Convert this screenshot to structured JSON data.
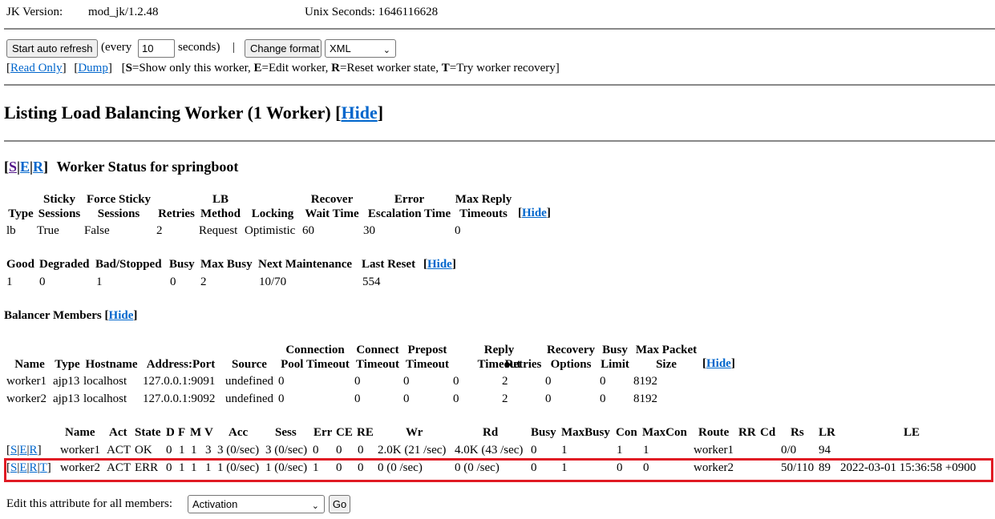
{
  "header": {
    "jk_version_label": "JK Version:",
    "jk_version_value": "mod_jk/1.2.48",
    "unix_seconds": "Unix Seconds: 1646116628"
  },
  "controls": {
    "auto_refresh_button": "Start auto refresh",
    "every_label": "(every",
    "refresh_seconds_value": "10",
    "seconds_label": "seconds)",
    "separator": "|",
    "change_format_button": "Change format",
    "format_select": "XML",
    "read_only_link": "Read Only",
    "dump_link": "Dump",
    "legend": {
      "S": "S",
      "S_text": "=Show only this worker, ",
      "E": "E",
      "E_text": "=Edit worker, ",
      "R": "R",
      "R_text": "=Reset worker state, ",
      "T": "T",
      "T_text": "=Try worker recovery]"
    }
  },
  "listing": {
    "title": "Listing Load Balancing Worker (1 Worker) [",
    "hide": "Hide",
    "close": "]"
  },
  "worker_status": {
    "links": [
      "S",
      "E",
      "R"
    ],
    "title": "Worker Status for springboot",
    "config_headers": [
      [
        "",
        "Type"
      ],
      [
        "Sticky",
        "Sessions"
      ],
      [
        "Force Sticky",
        "Sessions"
      ],
      [
        "",
        "Retries"
      ],
      [
        "LB",
        "Method"
      ],
      [
        "",
        "Locking"
      ],
      [
        "Recover",
        "Wait Time"
      ],
      [
        "Error",
        "Escalation Time"
      ],
      [
        "Max Reply",
        "Timeouts"
      ]
    ],
    "config_values": [
      "lb",
      "True",
      "False",
      "2",
      "Request",
      "Optimistic",
      "60",
      "30",
      "0"
    ],
    "status_headers": [
      "Good",
      "Degraded",
      "Bad/Stopped",
      "Busy",
      "Max Busy",
      "Next Maintenance",
      "Last Reset"
    ],
    "status_values": [
      "1",
      "0",
      "1",
      "0",
      "2",
      "10/70",
      "554"
    ],
    "hide": "Hide"
  },
  "balancer_members": {
    "title": "Balancer Members [",
    "hide": "Hide",
    "close": "]",
    "headers": [
      [
        "",
        "Name"
      ],
      [
        "",
        "Type"
      ],
      [
        "",
        "Hostname"
      ],
      [
        "",
        "Address:Port"
      ],
      [
        "",
        "Source"
      ],
      [
        "Connection",
        "Pool Timeout"
      ],
      [
        "Connect",
        "Timeout"
      ],
      [
        "Prepost",
        "Timeout"
      ],
      [
        "Reply",
        "Timeout"
      ],
      [
        "",
        "Retries"
      ],
      [
        "Recovery",
        "Options"
      ],
      [
        "Busy",
        "Limit"
      ],
      [
        "Max Packet",
        "Size"
      ]
    ],
    "rows": [
      [
        "worker1",
        "ajp13",
        "localhost",
        "127.0.0.1:9091",
        "undefined",
        "0",
        "0",
        "0",
        "0",
        "2",
        "0",
        "0",
        "8192"
      ],
      [
        "worker2",
        "ajp13",
        "localhost",
        "127.0.0.1:9092",
        "undefined",
        "0",
        "0",
        "0",
        "0",
        "2",
        "0",
        "0",
        "8192"
      ]
    ]
  },
  "runtime": {
    "headers": [
      "Name",
      "Act",
      "State",
      "D",
      "F",
      "M",
      "V",
      "Acc",
      "Sess",
      "Err",
      "CE",
      "RE",
      "Wr",
      "Rd",
      "Busy",
      "MaxBusy",
      "Con",
      "MaxCon",
      "Route",
      "RR",
      "Cd",
      "Rs",
      "LR",
      "LE"
    ],
    "rows": [
      {
        "links": [
          "S",
          "E",
          "R"
        ],
        "cells": [
          "worker1",
          "ACT",
          "OK",
          "0",
          "1",
          "1",
          "3",
          "3 (0/sec)",
          "3 (0/sec)",
          "0",
          "0",
          "0",
          "2.0K (21 /sec)",
          "4.0K (43 /sec)",
          "0",
          "1",
          "1",
          "1",
          "worker1",
          "",
          "",
          "0/0",
          "94",
          ""
        ]
      },
      {
        "links": [
          "S",
          "E",
          "R",
          "T"
        ],
        "cells": [
          "worker2",
          "ACT",
          "ERR",
          "0",
          "1",
          "1",
          "1",
          "1 (0/sec)",
          "1 (0/sec)",
          "1",
          "0",
          "0",
          "0 (0 /sec)",
          "0 (0 /sec)",
          "0",
          "1",
          "0",
          "0",
          "worker2",
          "",
          "",
          "50/110",
          "89",
          "2022-03-01 15:36:58 +0900"
        ]
      }
    ]
  },
  "edit_all": {
    "label": "Edit this attribute for all members:",
    "select_value": "Activation",
    "go_button": "Go"
  },
  "colors": {
    "link": "#0066cc",
    "highlight": "#e01b24",
    "rule": "#888888"
  }
}
